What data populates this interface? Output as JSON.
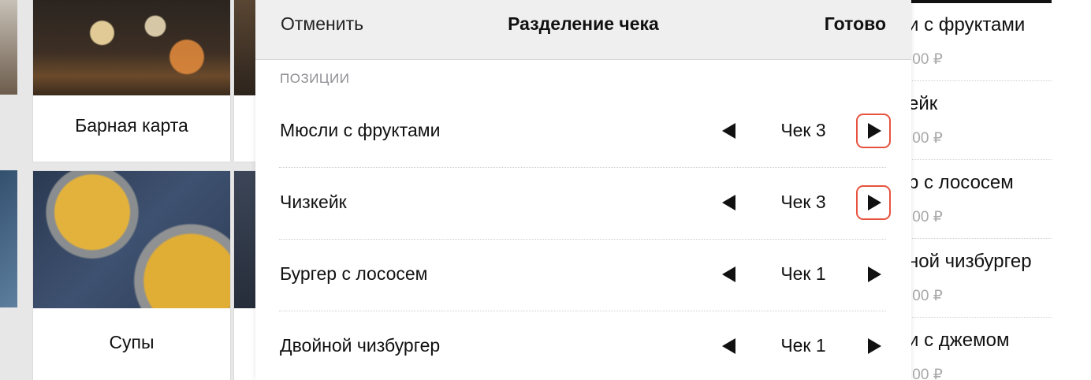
{
  "background_menu": {
    "tiles": [
      {
        "label": "Барная карта"
      },
      {
        "label": "Супы"
      }
    ]
  },
  "background_order": {
    "items": [
      {
        "name": "и с фруктами",
        "price": ",00 ₽"
      },
      {
        "name": "ейк",
        "price": ",00 ₽"
      },
      {
        "name": "р с лососем",
        "price": ",00 ₽"
      },
      {
        "name": "ной чизбургер",
        "price": ",00 ₽"
      },
      {
        "name": "и с джемом",
        "price": ",00 ₽"
      }
    ]
  },
  "sheet": {
    "cancel_label": "Отменить",
    "title": "Разделение чека",
    "done_label": "Готово",
    "section_label": "ПОЗИЦИИ",
    "rows": [
      {
        "name": "Мюсли с фруктами",
        "check": "Чек 3"
      },
      {
        "name": "Чизкейк",
        "check": "Чек 3"
      },
      {
        "name": "Бургер с лососем",
        "check": "Чек 1"
      },
      {
        "name": "Двойной чизбургер",
        "check": "Чек 1"
      }
    ]
  },
  "colors": {
    "highlight": "#e8533f",
    "header_bg": "#efefef",
    "muted_text": "#8e8e93"
  },
  "icons": {
    "prev": "triangle-left-icon",
    "next": "triangle-right-icon"
  }
}
